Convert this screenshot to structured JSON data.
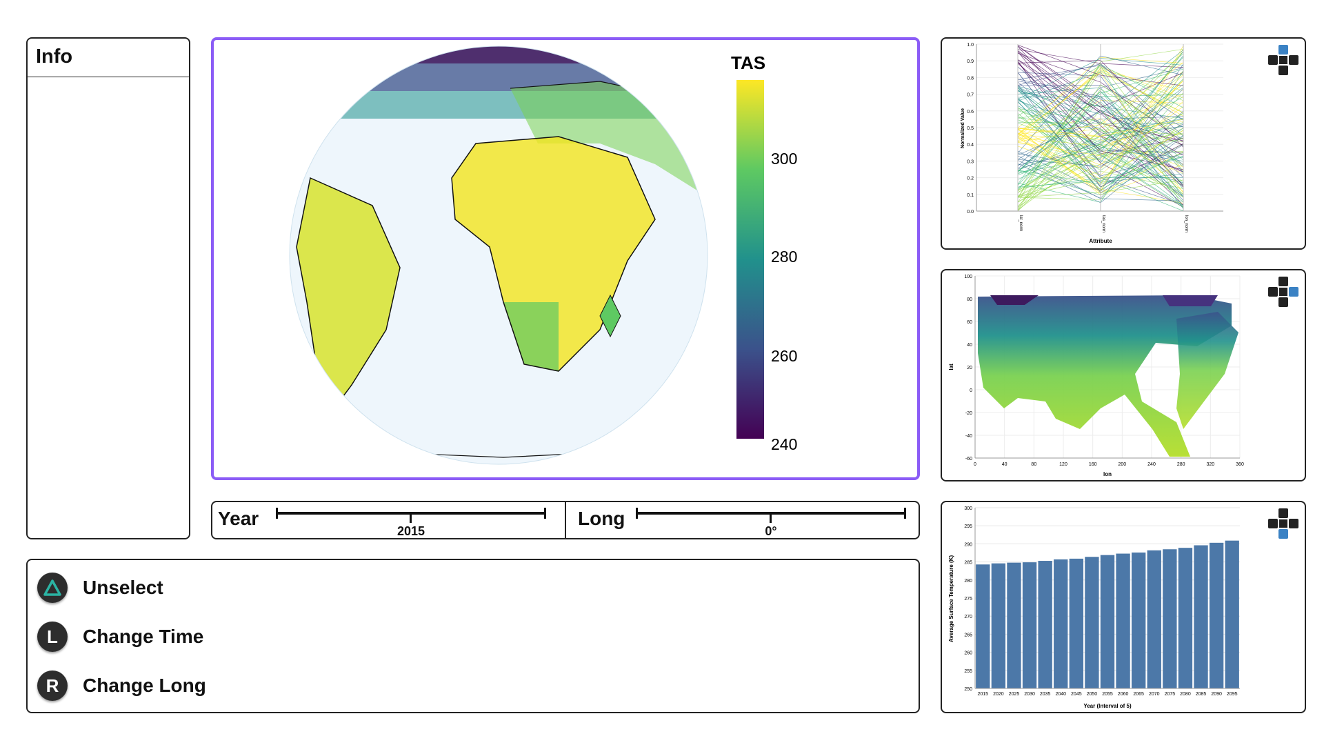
{
  "info": {
    "title": "Info"
  },
  "globe": {
    "legend_title": "TAS",
    "legend_ticks": [
      "300",
      "280",
      "260",
      "240"
    ]
  },
  "sliders": {
    "year": {
      "label": "Year",
      "value": "2015"
    },
    "long": {
      "label": "Long",
      "value": "0°"
    }
  },
  "controls": [
    {
      "button": "triangle",
      "label": "Unselect"
    },
    {
      "button": "L",
      "label": "Change Time"
    },
    {
      "button": "R",
      "label": "Change Long"
    }
  ],
  "parallel_chart": {
    "ylabel": "Normalized Value",
    "xlabel": "Attribute",
    "axes": [
      "lat_norm",
      "tas_norm",
      "lon_norm"
    ],
    "yticks": [
      "1.0",
      "0.9",
      "0.8",
      "0.7",
      "0.6",
      "0.5",
      "0.4",
      "0.3",
      "0.2",
      "0.1",
      "0.0"
    ]
  },
  "map_chart": {
    "ylabel": "lat",
    "xlabel": "lon",
    "yticks": [
      "100",
      "80",
      "60",
      "40",
      "20",
      "0",
      "-20",
      "-40",
      "-60"
    ],
    "xticks": [
      "0",
      "40",
      "80",
      "120",
      "160",
      "200",
      "240",
      "280",
      "320",
      "360"
    ]
  },
  "chart_data": {
    "type": "bar",
    "ylabel": "Average Surface Temperature (K)",
    "xlabel": "Year (Interval of 5)",
    "ylim": [
      250,
      300
    ],
    "yticks": [
      "300",
      "295",
      "290",
      "285",
      "280",
      "275",
      "270",
      "265",
      "260",
      "255",
      "250"
    ],
    "categories": [
      "2015",
      "2020",
      "2025",
      "2030",
      "2035",
      "2040",
      "2045",
      "2050",
      "2055",
      "2060",
      "2065",
      "2070",
      "2075",
      "2080",
      "2085",
      "2090",
      "2095"
    ],
    "values": [
      284.3,
      284.6,
      284.8,
      284.9,
      285.3,
      285.7,
      285.9,
      286.4,
      286.9,
      287.3,
      287.6,
      288.2,
      288.5,
      288.9,
      289.6,
      290.3,
      290.9
    ],
    "bar_color": "#4c78a8"
  },
  "colors": {
    "accent": "#8b5cf6",
    "triangle": "#2bb3a3",
    "dpad_blue": "#3b82c4"
  }
}
